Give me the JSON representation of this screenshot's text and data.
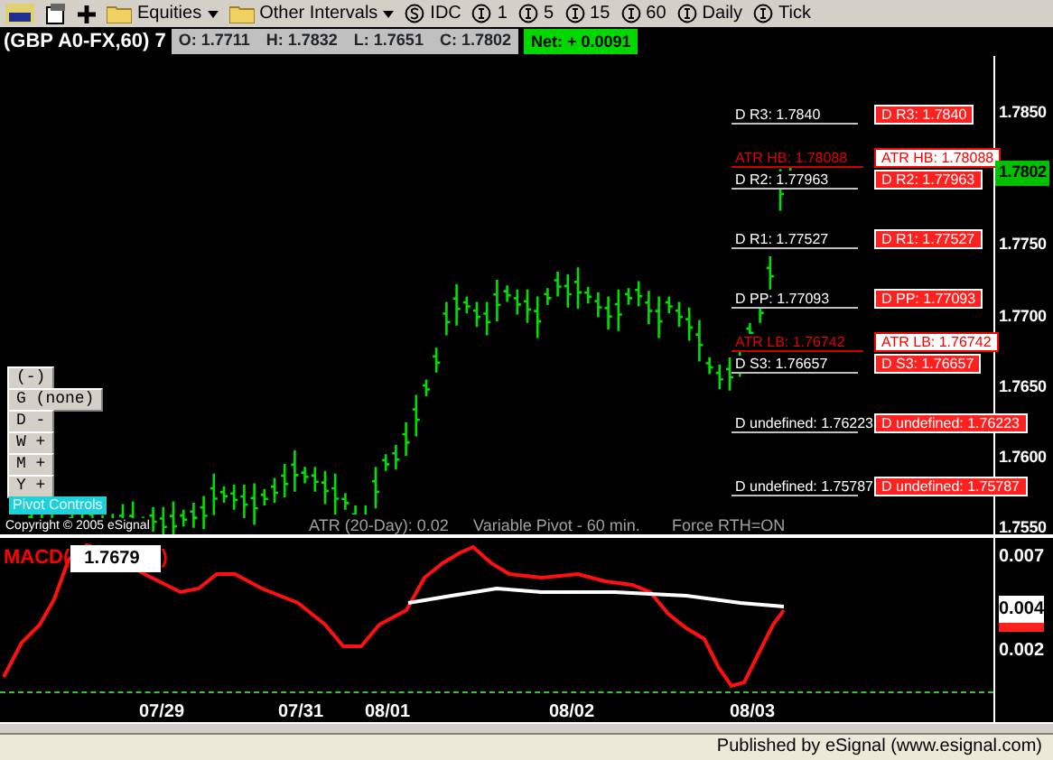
{
  "toolbar": {
    "items": [
      {
        "kind": "menu",
        "label": "Equities"
      },
      {
        "kind": "menu",
        "label": "Other Intervals"
      },
      {
        "kind": "source",
        "label": "IDC"
      },
      {
        "kind": "interval",
        "label": "1"
      },
      {
        "kind": "interval",
        "label": "5"
      },
      {
        "kind": "interval",
        "label": "15"
      },
      {
        "kind": "interval",
        "label": "60"
      },
      {
        "kind": "interval",
        "label": "Daily"
      },
      {
        "kind": "interval",
        "label": "Tick"
      }
    ]
  },
  "header": {
    "symbol": "(GBP A0-FX,60) 7",
    "quotes": [
      {
        "label": "O:",
        "value": "1.7711"
      },
      {
        "label": "H:",
        "value": "1.7832"
      },
      {
        "label": "L:",
        "value": "1.7651"
      },
      {
        "label": "C:",
        "value": "1.7802"
      }
    ],
    "net": "Net: + 0.0091"
  },
  "price_chart": {
    "pivots": [
      {
        "kind": "daily",
        "label": "D R3:  1.7840",
        "tag": "D R3:  1.7840"
      },
      {
        "kind": "atr",
        "label": "ATR HB: 1.78088",
        "tag": "ATR HB: 1.78088"
      },
      {
        "kind": "daily",
        "label": "D R2: 1.77963",
        "tag": "D R2: 1.77963"
      },
      {
        "kind": "daily",
        "label": "D R1: 1.77527",
        "tag": "D R1: 1.77527"
      },
      {
        "kind": "daily",
        "label": "D PP: 1.77093",
        "tag": "D PP: 1.77093"
      },
      {
        "kind": "atr",
        "label": "ATR LB: 1.76742",
        "tag": "ATR LB: 1.76742"
      },
      {
        "kind": "daily",
        "label": "D S3: 1.76657",
        "tag": "D S3: 1.76657"
      },
      {
        "kind": "daily",
        "label": "D undefined: 1.76223",
        "tag": "D undefined: 1.76223"
      },
      {
        "kind": "daily",
        "label": "D undefined: 1.75787",
        "tag": "D undefined: 1.75787"
      }
    ],
    "axis_labels": [
      {
        "label": "1.7850",
        "current": false
      },
      {
        "label": "1.7802",
        "current": true
      },
      {
        "label": "1.7750",
        "current": false
      },
      {
        "label": "1.7700",
        "current": false
      },
      {
        "label": "1.7650",
        "current": false
      },
      {
        "label": "1.7600",
        "current": false
      },
      {
        "label": "1.7550",
        "current": false
      }
    ],
    "controls": [
      {
        "label": "(-)",
        "kind": "button"
      },
      {
        "label": "G  (none)",
        "kind": "button"
      },
      {
        "label": "D  -",
        "kind": "button"
      },
      {
        "label": "W  +",
        "kind": "button"
      },
      {
        "label": "M  +",
        "kind": "button"
      },
      {
        "label": "Y  +",
        "kind": "button"
      },
      {
        "label": "Pivot Controls",
        "kind": "panel"
      }
    ],
    "copyright": "Copyright © 2005 eSignal",
    "footer_notes": [
      "ATR (20-Day): 0.02",
      "Variable Pivot - 60 min.",
      "Force RTH=ON"
    ]
  },
  "macd": {
    "title_start": "MACD(",
    "value": "1.7679",
    "title_end": ")",
    "axis_labels": [
      {
        "label": "0.007",
        "current": false
      },
      {
        "label": "0.004",
        "current": true
      },
      {
        "label": "0.002",
        "current": false
      }
    ]
  },
  "dates": [
    "07/29",
    "07/31",
    "08/01",
    "08/02",
    "08/03"
  ],
  "status_bar": "Published by eSignal (www.esignal.com)"
}
